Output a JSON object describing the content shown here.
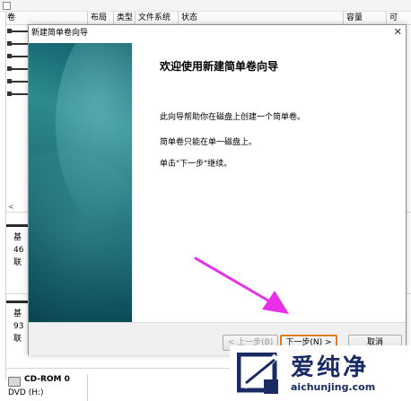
{
  "background": {
    "columns": [
      "卷",
      "布局",
      "类型",
      "文件系统",
      "状态",
      "容量",
      "可"
    ],
    "disks": [
      {
        "line1": "基",
        "line2": "46",
        "line3": "联"
      },
      {
        "line1": "基",
        "line2": "93",
        "line3": "联"
      }
    ],
    "cdrom": {
      "name": "CD-ROM 0",
      "sub": "DVD (H:)"
    }
  },
  "wizard": {
    "title": "新建简单卷向导",
    "close_icon": "close-icon",
    "heading": "欢迎使用新建简单卷向导",
    "text1": "此向导帮助你在磁盘上创建一个简单卷。",
    "text2": "简单卷只能在单一磁盘上。",
    "text3": "单击\"下一步\"继续。",
    "buttons": {
      "back": "< 上一步(B)",
      "next": "下一步(N) >",
      "cancel": "取消"
    },
    "accent_color": "#e07a16"
  },
  "annotation": {
    "arrow_color": "#e830e8"
  },
  "watermark": {
    "title": "爱纯净",
    "url": "aichunjing.com"
  }
}
